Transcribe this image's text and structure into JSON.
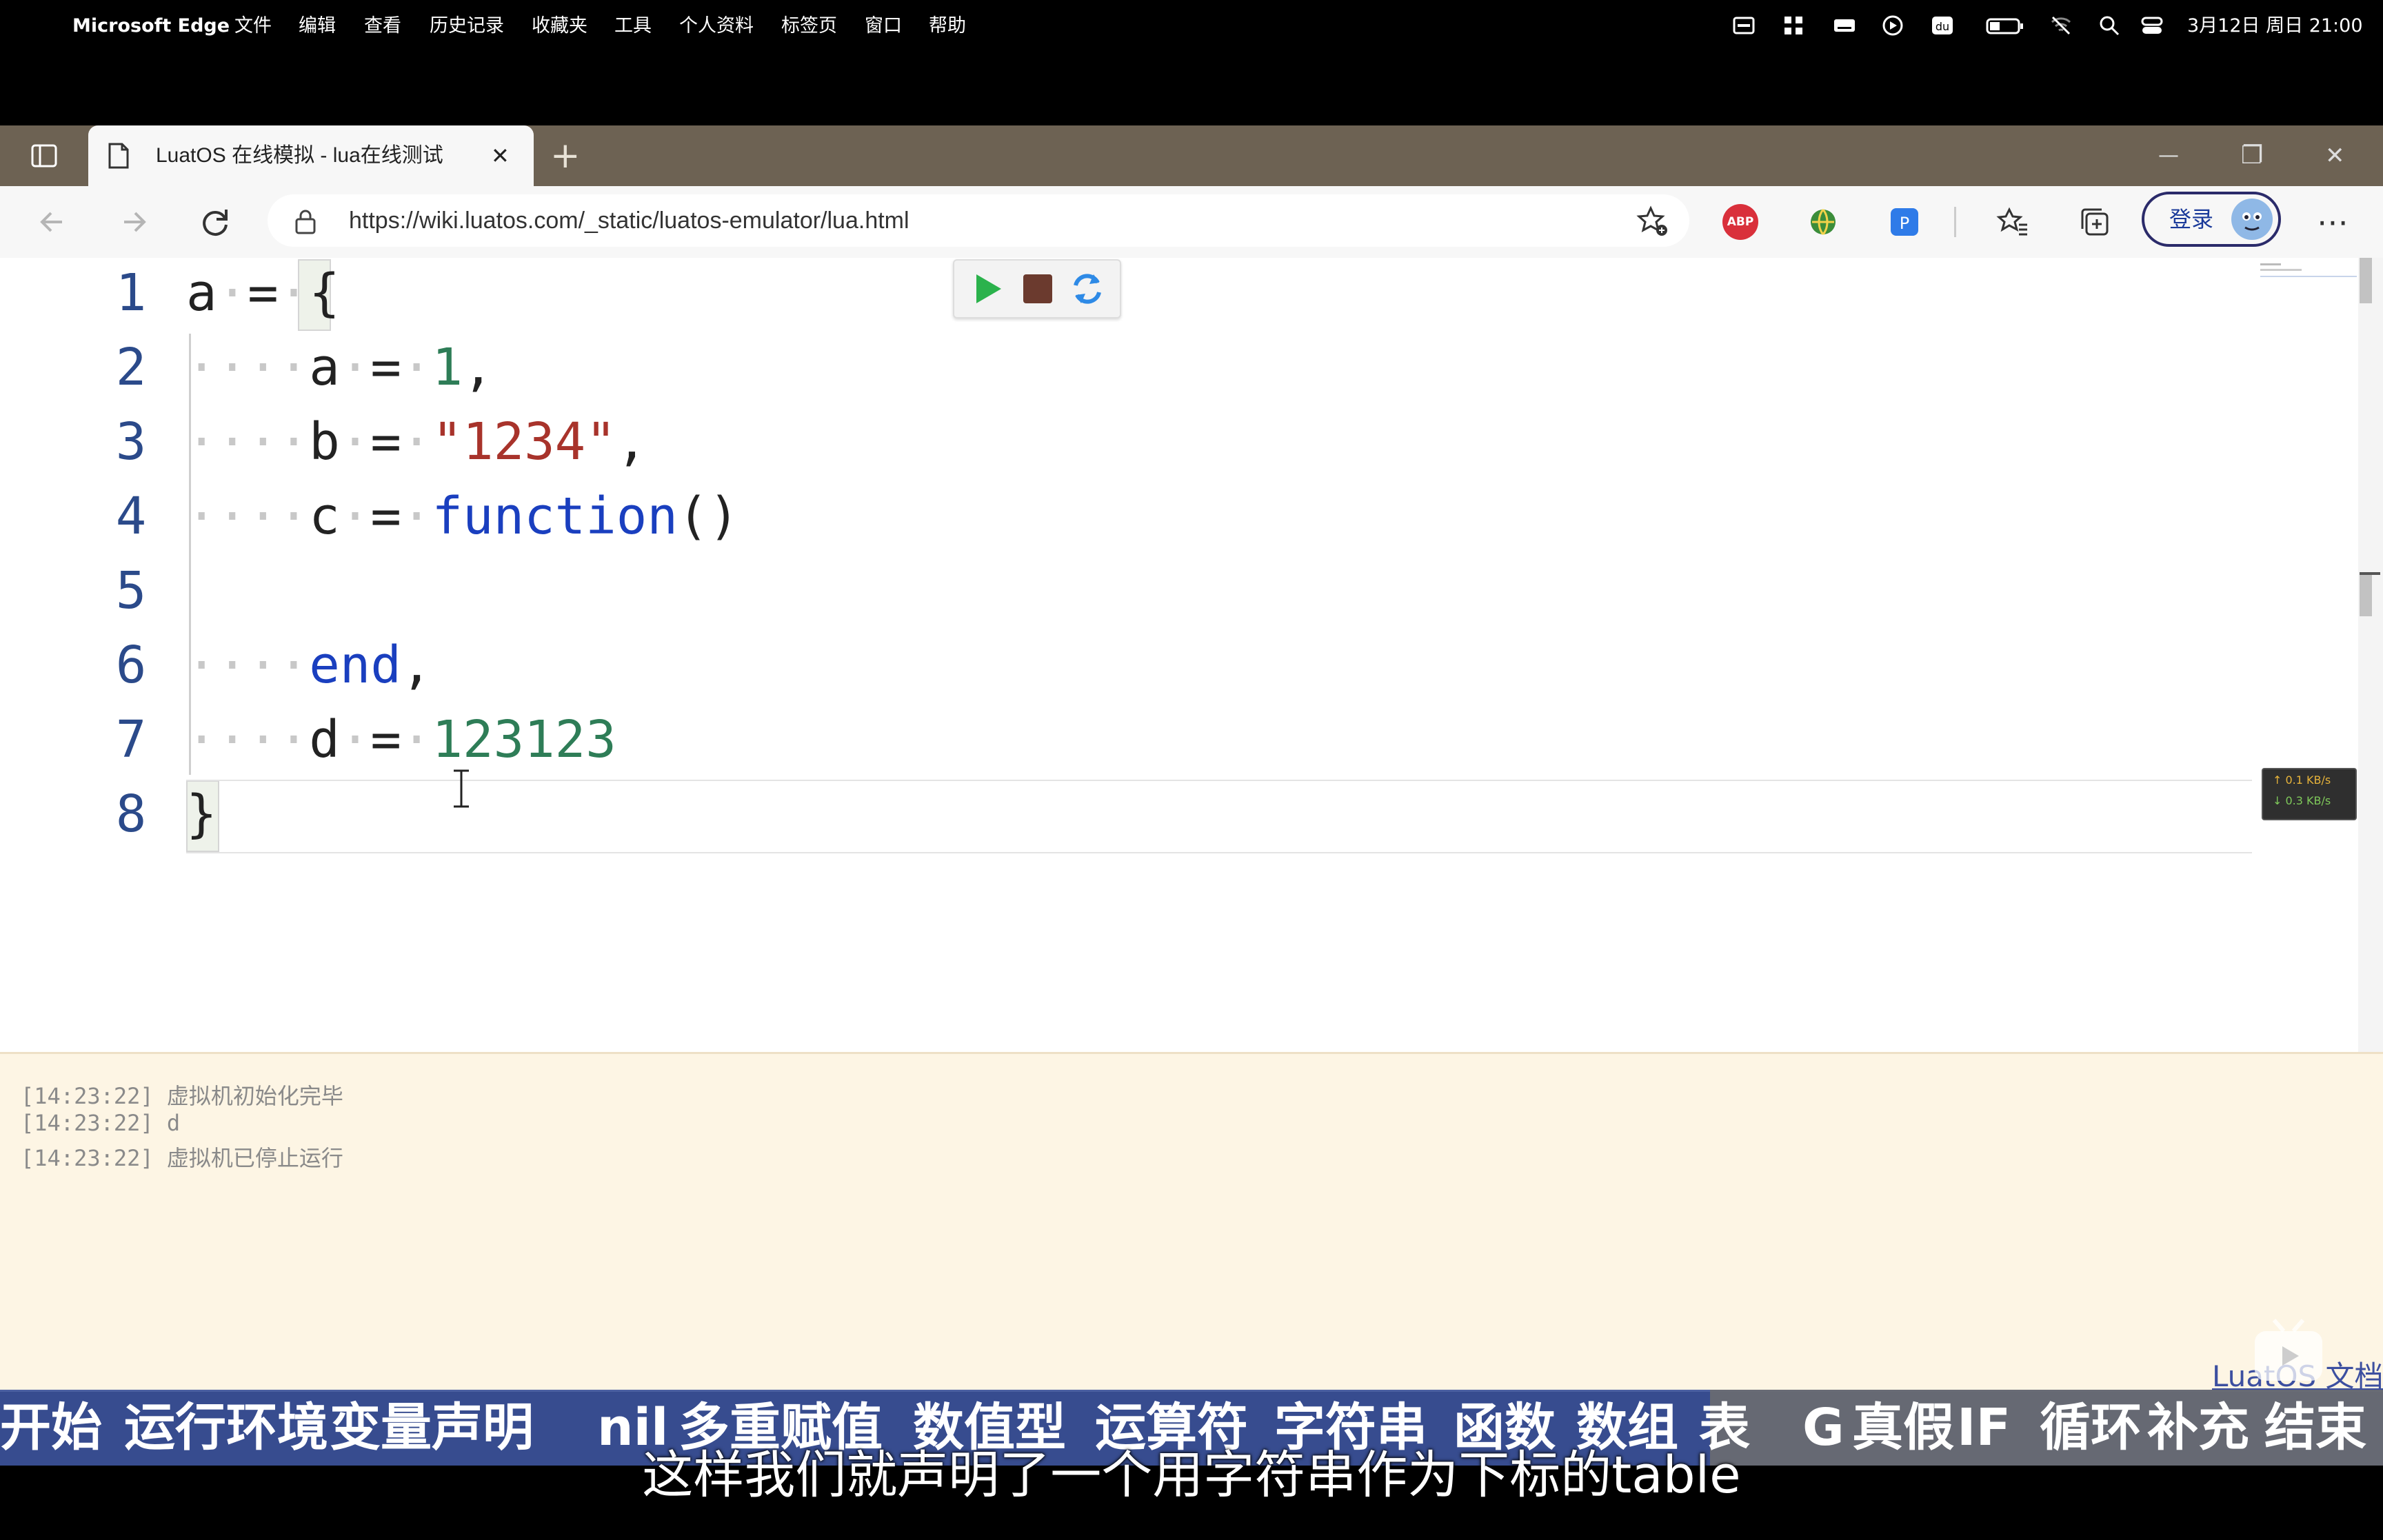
{
  "menubar": {
    "apple": "",
    "app": "Microsoft Edge",
    "items": [
      "文件",
      "编辑",
      "查看",
      "历史记录",
      "收藏夹",
      "工具",
      "个人资料",
      "标签页",
      "窗口",
      "帮助"
    ],
    "clock": "3月12日 周日 21:00"
  },
  "tab": {
    "title": "LuatOS 在线模拟 - lua在线测试",
    "close": "✕",
    "new_tab": "+"
  },
  "window_controls": {
    "minimize": "—",
    "restore": "❐",
    "close": "✕"
  },
  "address": {
    "url": "https://wiki.luatos.com/_static/luatos-emulator/lua.html"
  },
  "toolbar": {
    "login_label": "登录",
    "more": "⋯",
    "abp": "ABP"
  },
  "editor": {
    "line_numbers": [
      "1",
      "2",
      "3",
      "4",
      "5",
      "6",
      "7",
      "8"
    ],
    "lines": {
      "l1_a": "a",
      "l1_eq": "=",
      "l1_brace": "{",
      "l2_key": "a",
      "l2_eq": "=",
      "l2_val": "1",
      "l2_comma": ",",
      "l3_key": "b",
      "l3_eq": "=",
      "l3_val": "\"1234\"",
      "l3_comma": ",",
      "l4_key": "c",
      "l4_eq": "=",
      "l4_fn": "function",
      "l4_paren": "()",
      "l6_end": "end",
      "l6_comma": ",",
      "l7_key": "d",
      "l7_eq": "=",
      "l7_val": "123123",
      "l8_brace": "}"
    },
    "net_up": "↑ 0.1 KB/s",
    "net_down": "↓ 0.3 KB/s"
  },
  "console": {
    "logs": [
      "[14:23:22] 虚拟机初始化完毕",
      "[14:23:22] d",
      "[14:23:22] 虚拟机已停止运行"
    ],
    "docs_link": "LuatOS 文档"
  },
  "video": {
    "chapters": [
      "开始",
      "运行环境",
      "变量声明",
      "nil",
      "多重赋值",
      "数值型",
      "运算符",
      "字符串",
      "函数",
      "数组",
      "表",
      "G",
      "真假",
      "IF",
      "循环",
      "补充",
      "结束"
    ],
    "subtitle": "这样我们就声明了一个用字符串作为下标的table"
  },
  "colors": {
    "tabstrip": "#6d6253",
    "console_bg": "#fdf5e4",
    "chapter_bar": "#3c529b",
    "keyword": "#1a3fbf",
    "number": "#2e7d57",
    "string": "#a8332b"
  }
}
